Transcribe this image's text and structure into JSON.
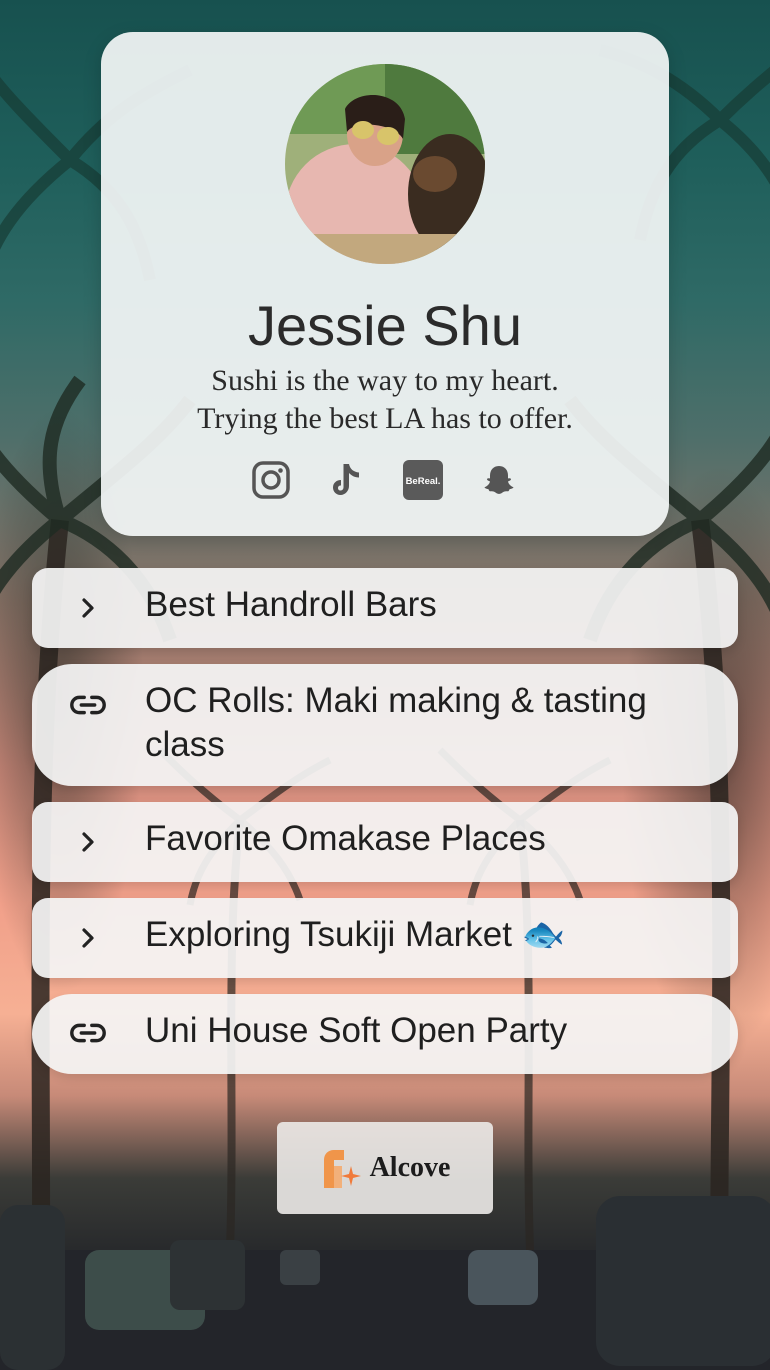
{
  "profile": {
    "name": "Jessie Shu",
    "bio_line1": "Sushi is the way to my heart.",
    "bio_line2": "Trying the best LA has to offer.",
    "socials": [
      {
        "icon": "instagram-icon"
      },
      {
        "icon": "tiktok-icon"
      },
      {
        "icon": "bereal-icon",
        "text": "BeReal."
      },
      {
        "icon": "snapchat-icon"
      }
    ]
  },
  "links": [
    {
      "icon": "chevron-right-icon",
      "label": "Best Handroll Bars"
    },
    {
      "icon": "link-icon",
      "label": "OC Rolls: Maki making & tasting class"
    },
    {
      "icon": "chevron-right-icon",
      "label": "Favorite Omakase Places"
    },
    {
      "icon": "chevron-right-icon",
      "label": "Exploring Tsukiji Market 🐟"
    },
    {
      "icon": "link-icon",
      "label": "Uni House Soft Open Party"
    }
  ],
  "footer": {
    "brand": "Alcove"
  },
  "colors": {
    "card_bg": "#f4f7f7",
    "text_dark": "#2b2b2b",
    "icon_gray": "#555555",
    "brand_orange": "#f08a3c"
  }
}
